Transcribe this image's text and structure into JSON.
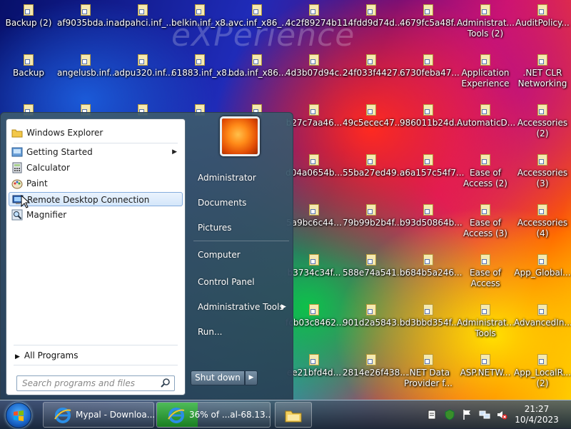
{
  "desktop": {
    "watermark": "eXPerience",
    "icons": [
      {
        "label": "Backup (2)"
      },
      {
        "label": "af9035bda.in..."
      },
      {
        "label": "adpahci.inf_..."
      },
      {
        "label": "belkin.inf_x8..."
      },
      {
        "label": "avc.inf_x86_..."
      },
      {
        "label": "4c2f89274b1..."
      },
      {
        "label": "14fdd9d74d..."
      },
      {
        "label": "4679fc5a48f..."
      },
      {
        "label": "Administrat... Tools (2)"
      },
      {
        "label": "AuditPolicy..."
      },
      {
        "label": "Backup"
      },
      {
        "label": "angelusb.inf..."
      },
      {
        "label": "adpu320.inf..."
      },
      {
        "label": "61883.inf_x8..."
      },
      {
        "label": "bda.inf_x86..."
      },
      {
        "label": "4d3b07d94c..."
      },
      {
        "label": "24f033f4427..."
      },
      {
        "label": "6730feba47..."
      },
      {
        "label": "Application Experience"
      },
      {
        "label": ".NET CLR Networking"
      },
      {
        "label": "b27c7aa46..."
      },
      {
        "label": "49c5ecec47..."
      },
      {
        "label": "986011b24d..."
      },
      {
        "label": "AutomaticD..."
      },
      {
        "label": "Accessories (2)"
      },
      {
        "label": "d04a0654b..."
      },
      {
        "label": "55ba27ed49..."
      },
      {
        "label": "a6a157c54f7..."
      },
      {
        "label": "Ease of Access (2)"
      },
      {
        "label": "Accessories (3)"
      },
      {
        "label": "5a9bc6c44..."
      },
      {
        "label": "79b99b2b4f..."
      },
      {
        "label": "b93d50864b..."
      },
      {
        "label": "Ease of Access (3)"
      },
      {
        "label": "Accessories (4)"
      },
      {
        "label": "b3734c34f..."
      },
      {
        "label": "588e74a541..."
      },
      {
        "label": "b684b5a246..."
      },
      {
        "label": "Ease of Access"
      },
      {
        "label": "App_Global..."
      },
      {
        "label": "fcb03c8462..."
      },
      {
        "label": "901d2a5843..."
      },
      {
        "label": "bd3bbd354f..."
      },
      {
        "label": "Administrat... Tools"
      },
      {
        "label": "AdvancedIn..."
      },
      {
        "label": "ee21bfd4d..."
      },
      {
        "label": "2814e26f438..."
      },
      {
        "label": ".NET Data Provider f..."
      },
      {
        "label": "ASP.NETW..."
      },
      {
        "label": "App_LocalR... (2)"
      }
    ]
  },
  "start_menu": {
    "programs": [
      {
        "label": "Windows Explorer",
        "icon": "folder-icon"
      },
      {
        "label": "Getting Started",
        "icon": "getting-started-icon",
        "has_submenu": true
      },
      {
        "label": "Calculator",
        "icon": "calculator-icon"
      },
      {
        "label": "Paint",
        "icon": "paint-icon"
      },
      {
        "label": "Remote Desktop Connection",
        "icon": "remote-desktop-icon",
        "selected": true
      },
      {
        "label": "Magnifier",
        "icon": "magnifier-icon"
      }
    ],
    "all_programs": "All Programs",
    "search_placeholder": "Search programs and files",
    "right_links": [
      {
        "label": "Administrator"
      },
      {
        "label": "Documents"
      },
      {
        "label": "Pictures"
      },
      {
        "label": "Computer"
      },
      {
        "label": "Control Panel"
      },
      {
        "label": "Administrative Tools",
        "has_submenu": true
      },
      {
        "label": "Run..."
      }
    ],
    "shutdown": "Shut down"
  },
  "taskbar": {
    "buttons": [
      {
        "label": "Mypal - Downloa...",
        "icon": "ie-icon"
      },
      {
        "label": "36% of ...al-68.13....",
        "icon": "ie-icon",
        "progress": 0.36
      },
      {
        "label": "",
        "icon": "explorer-folder-icon"
      }
    ],
    "clock": {
      "time": "21:27",
      "date": "10/4/2023"
    }
  },
  "colors": {
    "accent": "#1761c4",
    "selection": "#d4e6fa",
    "progress": "#2fb52f"
  }
}
